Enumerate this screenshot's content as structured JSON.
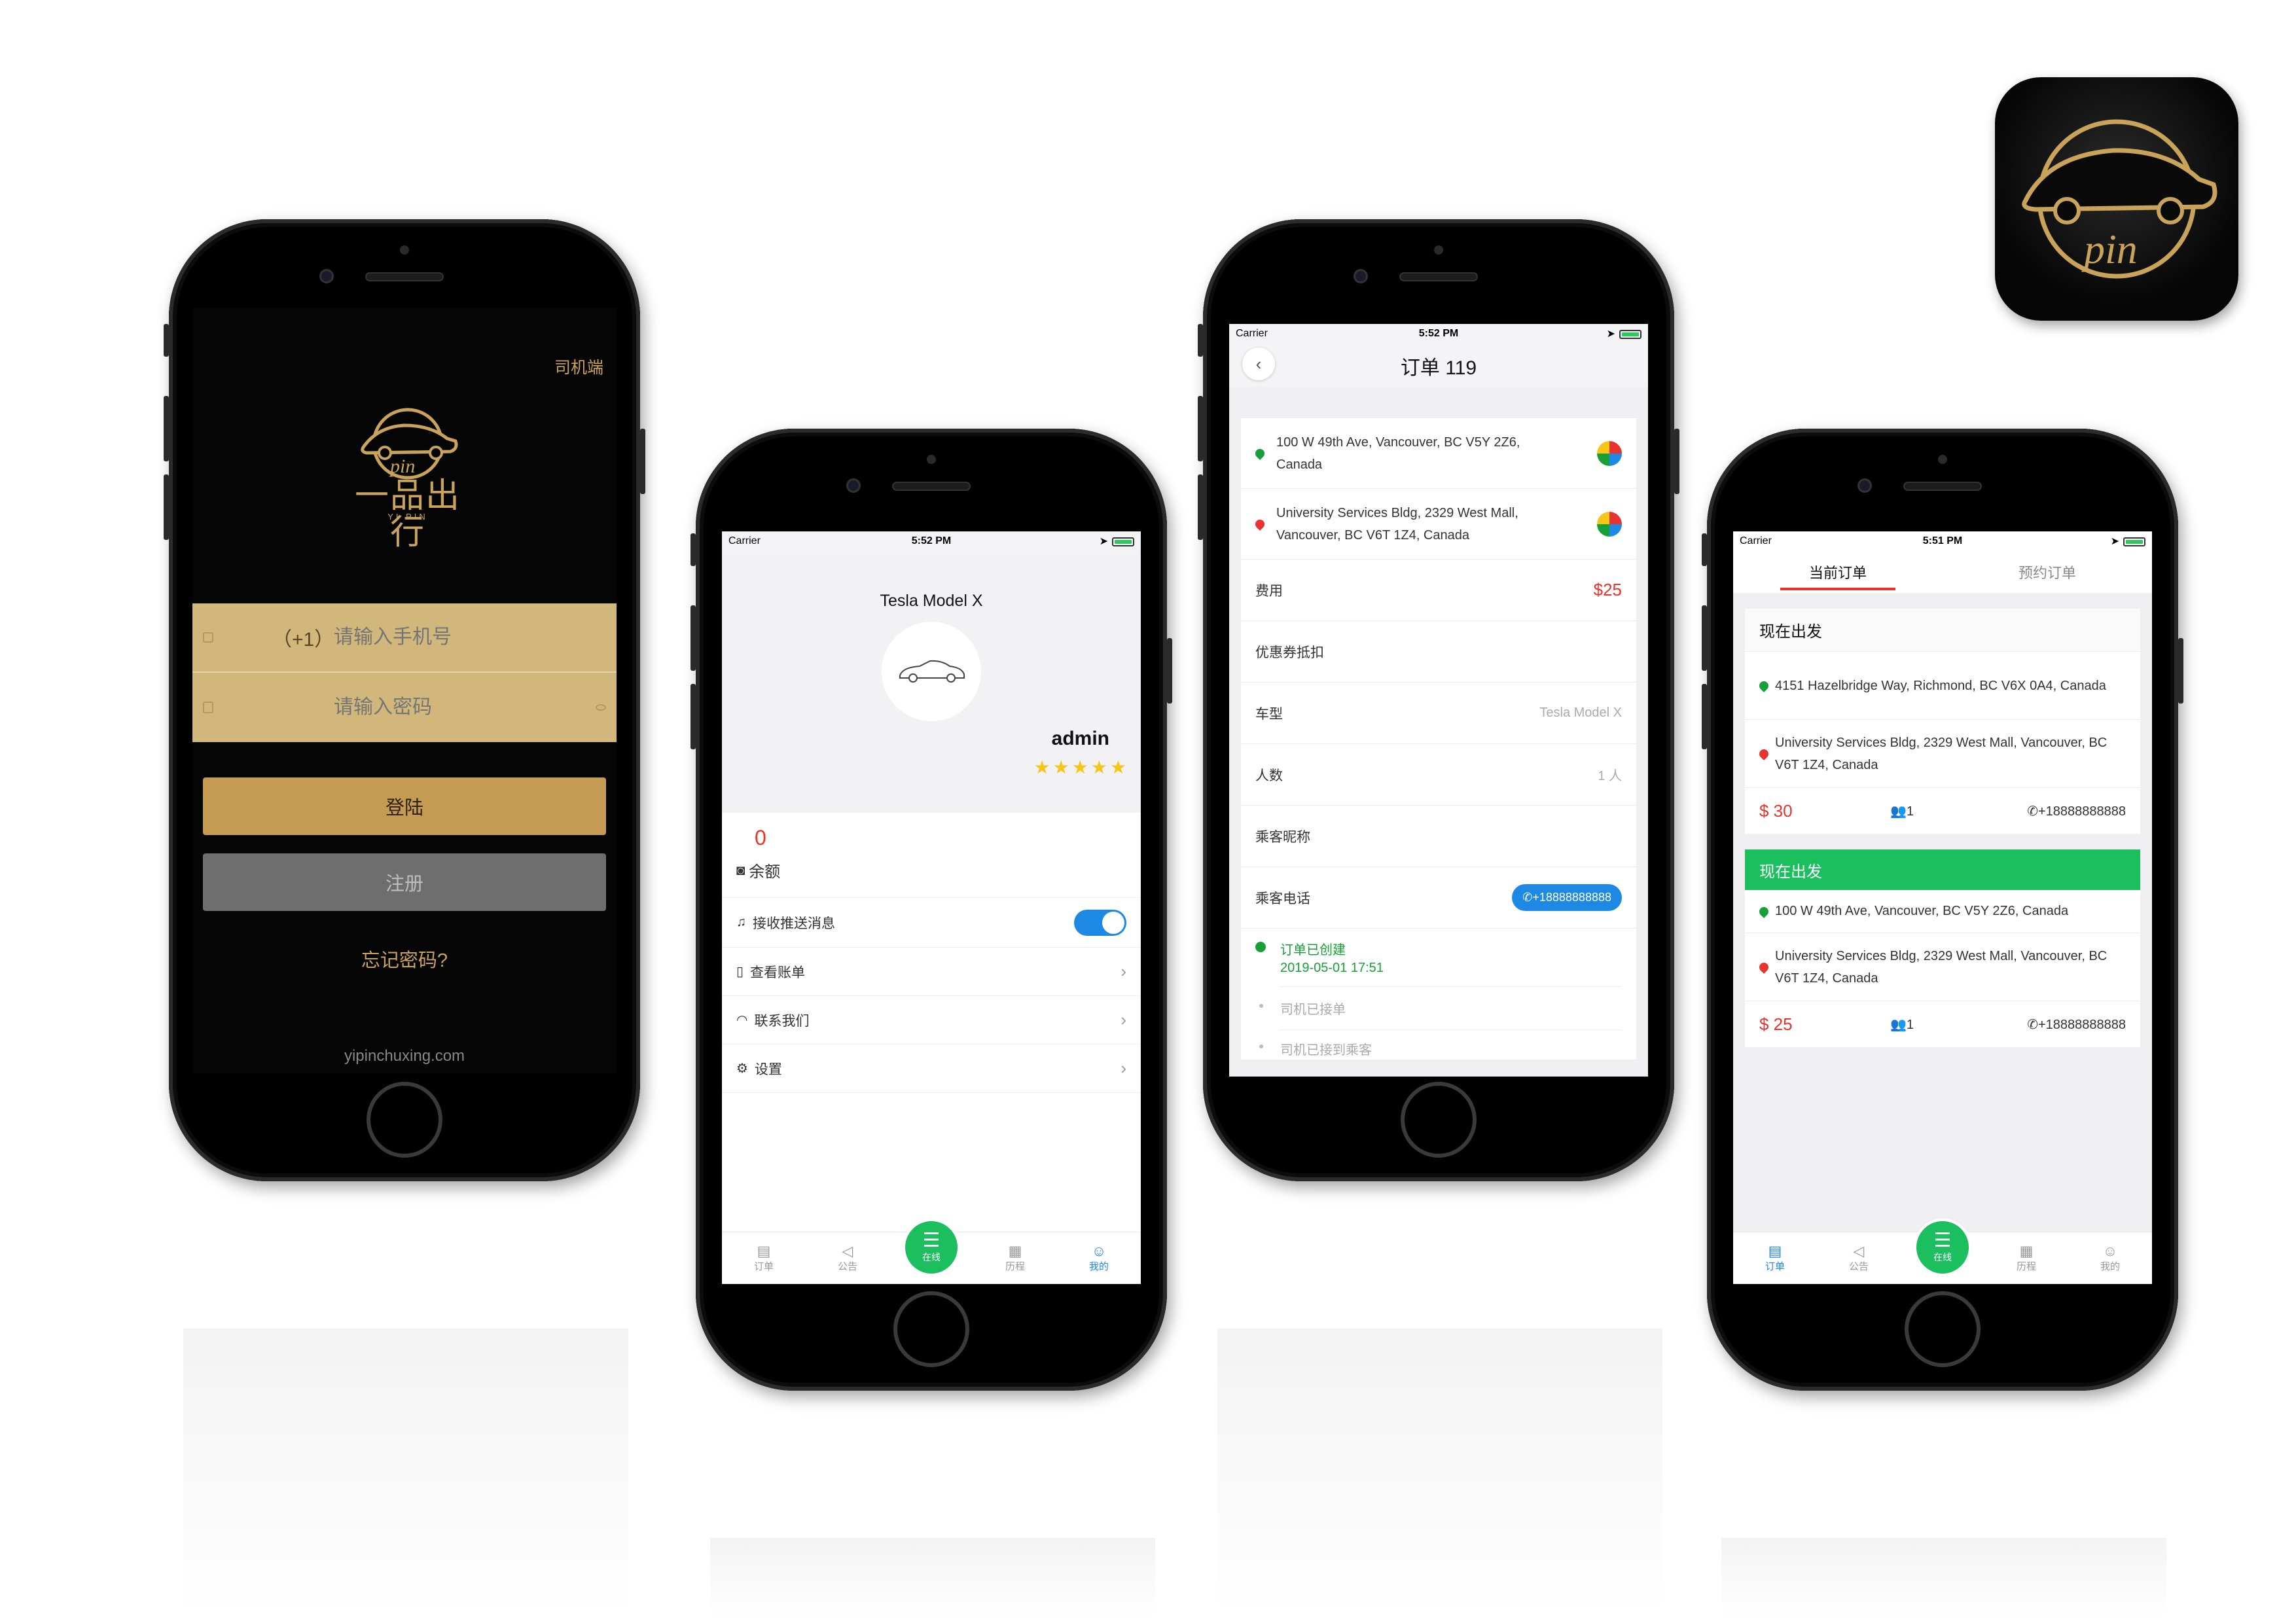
{
  "login": {
    "driver_label": "司机端",
    "logo_text": "一品出行",
    "logo_sub": "YI PIN",
    "phone_prefix": "（+1）",
    "phone_placeholder": "请输入手机号",
    "password_placeholder": "请输入密码",
    "login_button": "登陆",
    "register_button": "注册",
    "forgot_link": "忘记密码?",
    "footer": "yipinchuxing.com"
  },
  "profile": {
    "status": {
      "carrier": "Carrier",
      "time": "5:52 PM"
    },
    "car_model": "Tesla Model X",
    "username": "admin",
    "rating_stars": 5,
    "balance_value": "0",
    "balance_label": "余额",
    "menu": [
      {
        "icon": "bell-icon",
        "label": "接收推送消息",
        "toggle": true
      },
      {
        "icon": "bill-icon",
        "label": "查看账单"
      },
      {
        "icon": "headset-icon",
        "label": "联系我们"
      },
      {
        "icon": "gear-icon",
        "label": "设置"
      }
    ],
    "tabs": [
      "订单",
      "公告",
      "在线",
      "历程",
      "我的"
    ],
    "active_tab": "我的"
  },
  "order_detail": {
    "status": {
      "carrier": "Carrier",
      "time": "5:52 PM"
    },
    "title": "订单 119",
    "origin": "100 W 49th Ave, Vancouver, BC V5Y 2Z6, Canada",
    "destination": "University Services Bldg, 2329 West Mall, Vancouver, BC V6T 1Z4, Canada",
    "fields": [
      {
        "label": "费用",
        "value": "$25",
        "style": "price"
      },
      {
        "label": "优惠券抵扣",
        "value": ""
      },
      {
        "label": "车型",
        "value": "Tesla Model X"
      },
      {
        "label": "人数",
        "value": "1 人"
      },
      {
        "label": "乘客昵称",
        "value": ""
      },
      {
        "label": "乘客电话",
        "value": "+18888888888",
        "style": "phone"
      }
    ],
    "timeline": [
      {
        "label": "订单已创建",
        "time": "2019-05-01 17:51",
        "active": true
      },
      {
        "label": "司机已接单",
        "time": "",
        "active": false
      },
      {
        "label": "司机已接到乘客",
        "time": "",
        "active": false
      }
    ]
  },
  "orders": {
    "status": {
      "carrier": "Carrier",
      "time": "5:51 PM"
    },
    "tabs": [
      "当前订单",
      "预约订单"
    ],
    "cards": [
      {
        "header": "现在出发",
        "origin": "4151 Hazelbridge Way, Richmond, BC V6X 0A4, Canada",
        "destination": "University Services Bldg, 2329 West Mall, Vancouver, BC V6T 1Z4, Canada",
        "price": "$ 30",
        "passengers": "1",
        "phone": "+18888888888",
        "highlight": false
      },
      {
        "header": "现在出发",
        "origin": "100 W 49th Ave, Vancouver, BC V5Y 2Z6, Canada",
        "destination": "University Services Bldg, 2329 West Mall, Vancouver, BC V6T 1Z4, Canada",
        "price": "$ 25",
        "passengers": "1",
        "phone": "+18888888888",
        "highlight": true
      }
    ],
    "tab_labels": [
      "订单",
      "公告",
      "在线",
      "历程",
      "我的"
    ],
    "active_tab": "订单"
  },
  "colors": {
    "gold": "#c9a35a",
    "green": "#1bbf5d",
    "blue": "#1e88e5",
    "red": "#e8332f"
  }
}
